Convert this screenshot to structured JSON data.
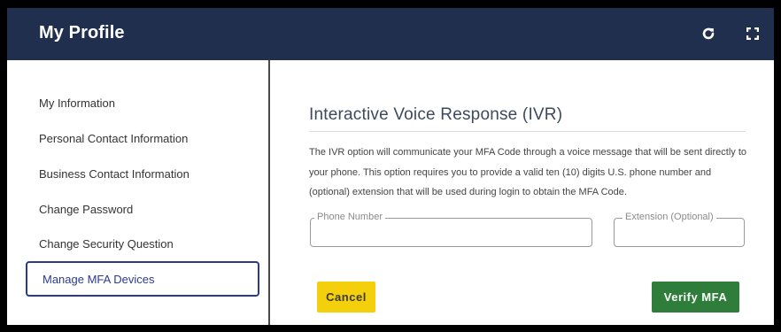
{
  "header": {
    "title": "My Profile",
    "refresh_icon": "refresh-icon",
    "expand_icon": "fullscreen-icon",
    "bg_color": "#1f2f4d"
  },
  "sidebar": {
    "items": [
      {
        "label": "My Information"
      },
      {
        "label": "Personal Contact Information"
      },
      {
        "label": "Business Contact Information"
      },
      {
        "label": "Change Password"
      },
      {
        "label": "Change Security Question"
      },
      {
        "label": "Manage MFA Devices",
        "active": true
      }
    ]
  },
  "main": {
    "heading": "Interactive Voice Response (IVR)",
    "description": "The IVR option will communicate your MFA Code through a voice message that will be sent directly to your phone. This option requires you to provide a valid ten (10) digits U.S. phone number and (optional) extension that will be used during login to obtain the MFA Code.",
    "phone": {
      "label": "Phone Number",
      "value": ""
    },
    "extension": {
      "label": "Extension (Optional)",
      "value": ""
    },
    "cancel_label": "Cancel",
    "verify_label": "Verify MFA",
    "cancel_color": "#f4cf0c",
    "verify_color": "#2f7d3a"
  }
}
